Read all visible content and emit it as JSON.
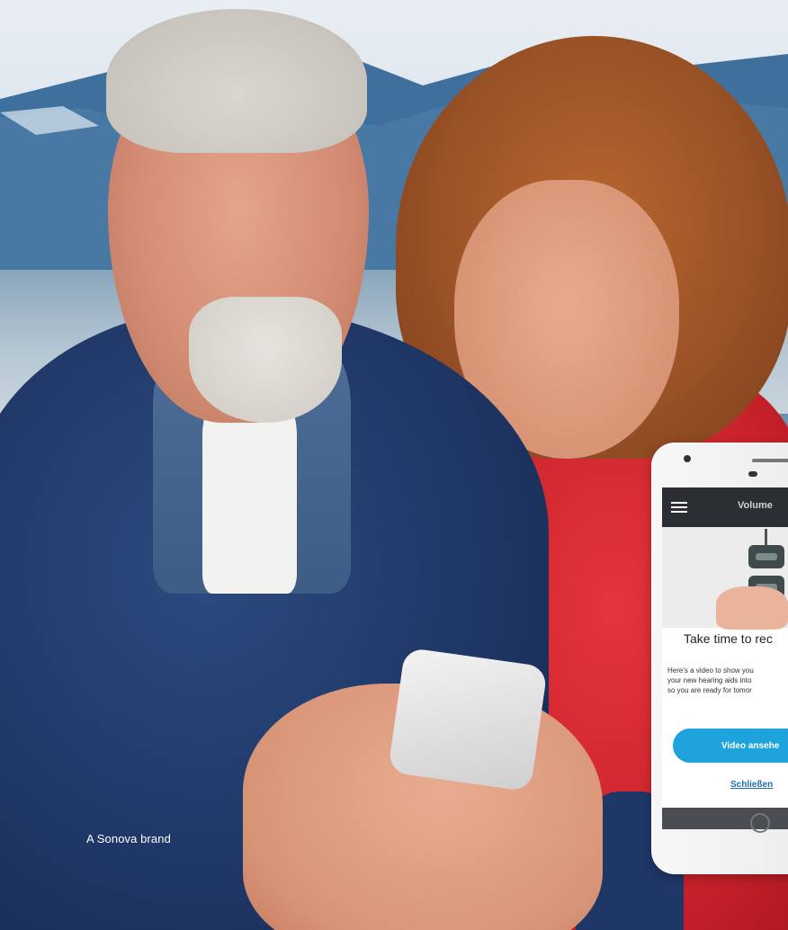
{
  "watermark": {
    "brand_text": "A Sonova brand"
  },
  "phone": {
    "app_title": "Volume",
    "menu_icon": "hamburger-menu-icon",
    "heading": "Take time to rec",
    "body_lines": [
      "Here's a video to show you",
      "your new hearing aids into",
      "so you are ready for tomor"
    ],
    "primary_button": "Video ansehe",
    "secondary_link": "Schließen",
    "colors": {
      "accent": "#1ea3dd",
      "appbar": "#2b2e33"
    }
  }
}
